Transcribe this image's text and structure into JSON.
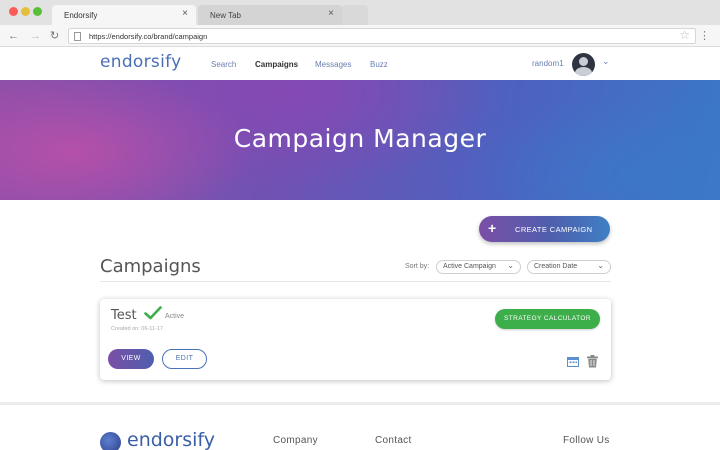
{
  "browser": {
    "tabs": [
      {
        "title": "Endorsify",
        "close": "×"
      },
      {
        "title": "New Tab",
        "close": "×"
      }
    ],
    "nav": {
      "back": "←",
      "forward": "→",
      "reload": "↻"
    },
    "url": "https://endorsify.co/brand/campaign",
    "bookmark_icon": "star-icon",
    "menu_glyph": "⋮"
  },
  "site": {
    "logo": "endorsify",
    "nav": [
      "Search",
      "Campaigns",
      "Messages",
      "Buzz"
    ],
    "active_nav": "Campaigns",
    "user": {
      "name": "random1",
      "chevron": "⌄"
    }
  },
  "hero": {
    "title": "Campaign Manager"
  },
  "actions": {
    "create_label": "CREATE CAMPAIGN",
    "create_icon": "+"
  },
  "campaigns": {
    "heading": "Campaigns",
    "sort_label": "Sort by:",
    "sort_options": {
      "primary": "Active Campaign",
      "secondary": "Creation Date",
      "caret": "⌄"
    },
    "items": [
      {
        "title": "Test",
        "status": "Active",
        "created": "Created on: 06-11-17",
        "strategy_label": "STRATEGY CALCULATOR",
        "view_label": "VIEW",
        "edit_label": "EDIT"
      }
    ]
  },
  "footer": {
    "logo": "endorsify",
    "columns": [
      "Company",
      "Contact",
      "Follow Us"
    ]
  },
  "colors": {
    "brand_blue": "#4a6fb5",
    "accent_purple": "#7a4fa6",
    "success_green": "#3cae4a"
  }
}
